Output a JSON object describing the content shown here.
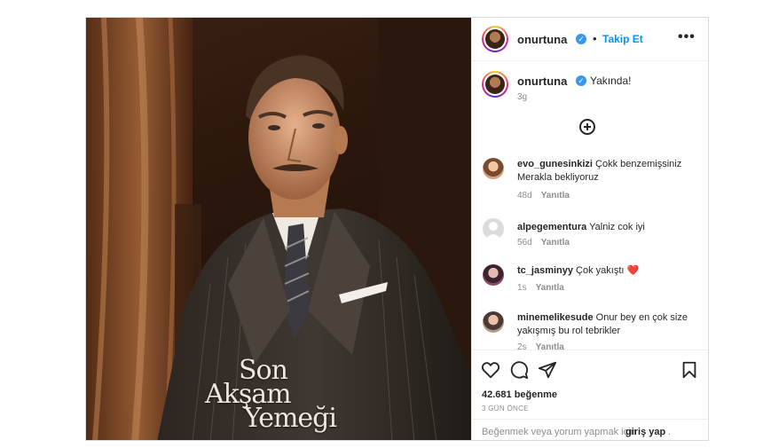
{
  "post": {
    "author": {
      "username": "onurtuna",
      "verified": true,
      "follow_label": "Takip Et",
      "separator": "•",
      "more_label": "•••"
    },
    "media": {
      "title_lines": [
        "Son",
        "Akşam",
        "Yemeği"
      ]
    },
    "caption": {
      "username": "onurtuna",
      "text": "Yakında!",
      "age": "3g"
    },
    "comments": [
      {
        "username": "evo_gunesinkizi",
        "text": "Çokk benzemişsiniz Merakla bekliyoruz",
        "age": "48d",
        "reply_label": "Yanıtla"
      },
      {
        "username": "alpegementura",
        "text": "Yalniz cok iyi",
        "age": "56d",
        "reply_label": "Yanıtla"
      },
      {
        "username": "tc_jasminyy",
        "text": "Çok yakıştı ❤️",
        "age": "1s",
        "reply_label": "Yanıtla"
      },
      {
        "username": "minemelikesude",
        "text": "Onur bey en çok size yakışmış bu rol tebrikler",
        "age": "2s",
        "reply_label": "Yanıtla"
      }
    ],
    "likes": "42.681 beğenme",
    "date": "3 GÜN ÖNCE",
    "login_prompt": {
      "prefix": "Beğenmek veya yorum yapmak için",
      "link": "giriş yap",
      "suffix": "."
    }
  }
}
